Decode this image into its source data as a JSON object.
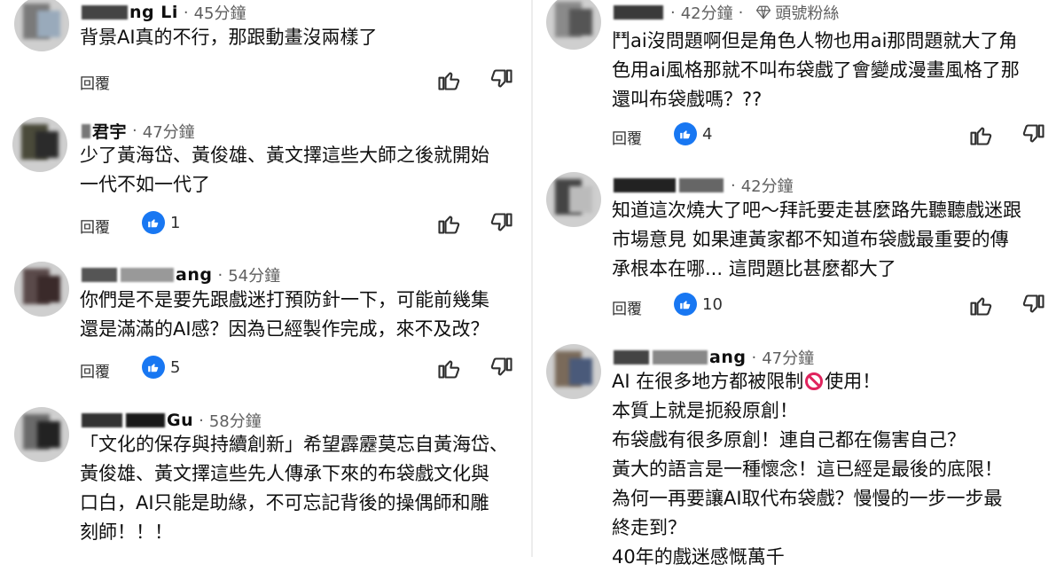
{
  "common": {
    "reply_label": "回覆"
  },
  "left": [
    {
      "author_visible": "ng Li",
      "time": "45分鐘",
      "text": "背景AI真的不行，那跟動畫沒兩樣了",
      "likes": ""
    },
    {
      "author_visible": "君宇",
      "time": "47分鐘",
      "text": "少了黃海岱、黃俊雄、黃文擇這些大師之後就開始\n一代不如一代了",
      "likes": "1"
    },
    {
      "author_visible": "ang",
      "time": "54分鐘",
      "text": "你們是不是要先跟戲迷打預防針一下，可能前幾集\n還是滿滿的AI感？因為已經製作完成，來不及改？",
      "likes": "5"
    },
    {
      "author_visible": "Gu",
      "time": "58分鐘",
      "text": "「文化的保存與持續創新」希望霹靂莫忘自黃海岱、\n黃俊雄、黃文擇這些先人傳承下來的布袋戲文化與\n口白，AI只能是助緣，不可忘記背後的操偶師和雕\n刻師！！！",
      "likes": ""
    }
  ],
  "right": [
    {
      "author_visible": "",
      "time": "42分鐘",
      "badge": "頭號粉絲",
      "text": "鬥ai沒問題啊但是角色人物也用ai那問題就大了角\n色用ai風格那就不叫布袋戲了會變成漫畫風格了那\n還叫布袋戲嗎？??",
      "likes": "4"
    },
    {
      "author_visible": "",
      "time": "42分鐘",
      "text": "知道這次燒大了吧～拜託要走甚麼路先聽聽戲迷跟\n市場意見 如果連黃家都不知道布袋戲最重要的傳\n承根本在哪... 這問題比甚麼都大了",
      "likes": "10"
    },
    {
      "author_visible": "ang",
      "time": "47分鐘",
      "text_before_icon": "AI 在很多地方都被限制",
      "text_after_icon": "使用！",
      "text_rest": "本質上就是扼殺原創！\n布袋戲有很多原創！連自己都在傷害自己？\n黃大的語言是一種懷念！這已經是最後的底限！\n為何一再要讓AI取代布袋戲？慢慢的一步一步最\n終走到？\n40年的戲迷感慨萬千",
      "icon": "no-entry-icon"
    }
  ]
}
